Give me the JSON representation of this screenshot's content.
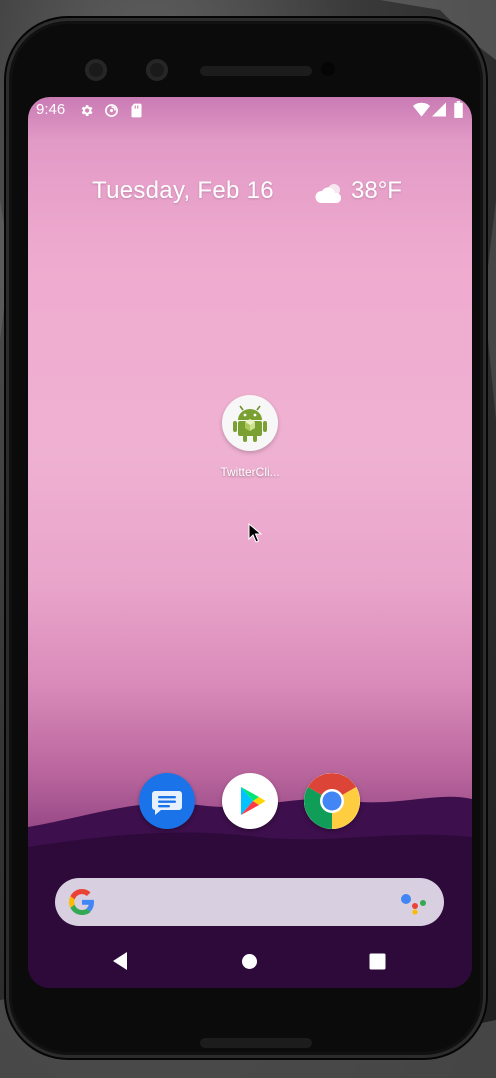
{
  "status_bar": {
    "time": "9:46",
    "icons": [
      "settings-icon",
      "no-sync-icon",
      "sd-card-icon",
      "wifi-icon",
      "signal-icon",
      "battery-icon"
    ]
  },
  "widget": {
    "date": "Tuesday, Feb 16",
    "weather_icon": "partly-cloudy-icon",
    "temperature": "38°F"
  },
  "home": {
    "apps": [
      {
        "label": "TwitterCli...",
        "icon": "android-icon"
      }
    ]
  },
  "dock": {
    "apps": [
      {
        "name": "messages",
        "icon": "messages-icon"
      },
      {
        "name": "play-store",
        "icon": "play-store-icon"
      },
      {
        "name": "chrome",
        "icon": "chrome-icon"
      }
    ]
  },
  "search_bar": {
    "logo": "google-g-icon",
    "assistant": "google-assistant-icon"
  },
  "nav_bar": {
    "buttons": [
      "back-icon",
      "home-icon",
      "recents-icon"
    ]
  },
  "colors": {
    "wallpaper_top": "#efabcf",
    "wallpaper_bottom": "#3a1048",
    "search_bar": "#d8d0e0",
    "messages_blue": "#1a73e8"
  }
}
